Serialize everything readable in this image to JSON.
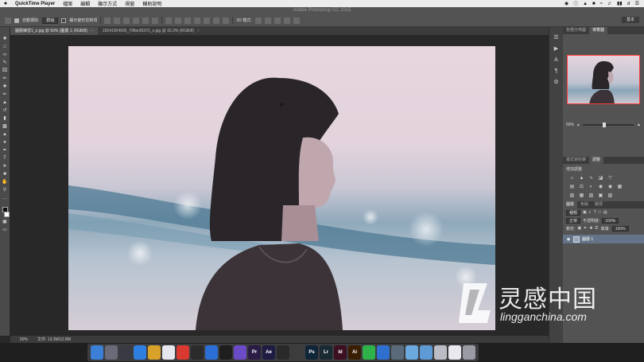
{
  "menubar": {
    "apple": "",
    "app": "QuickTime Player",
    "items": [
      "檔案",
      "編輯",
      "顯示方式",
      "視窗",
      "輔助說明"
    ]
  },
  "app_title": "Adobe Photoshop CC 2015",
  "options": {
    "auto_select_label": "自動選取:",
    "auto_select_value": "群組",
    "show_transform_label": "顯示變形控制項",
    "mode_3d": "3D 模式:",
    "workspace": "基本"
  },
  "tabs": [
    {
      "label": "圖層練習1_o.jpg @ 50% (圖層 1, RGB/8)",
      "close": "×",
      "active": true
    },
    {
      "label": "15041954695_79fbe39372_o.jpg @ 33.3% (RGB/8)",
      "close": "×",
      "active": false
    }
  ],
  "status": {
    "zoom": "50%",
    "doc": "文件: 13.3M/12.8M"
  },
  "navigator": {
    "tabs": [
      "色階分佈圖",
      "導覽器"
    ],
    "zoom": "50%"
  },
  "adjust": {
    "tabs": [
      "樣式資料庫",
      "調整"
    ],
    "subtitle": "增加調整"
  },
  "layers": {
    "tabs": [
      "圖層",
      "色版",
      "路徑"
    ],
    "kind": "種類",
    "blend": "正常",
    "opacity_label": "不透明度:",
    "opacity": "100%",
    "lock_label": "鎖定:",
    "fill_label": "填滿:",
    "fill": "100%",
    "layer_name": "圖層 1"
  },
  "dock_apps": [
    {
      "name": "finder",
      "label": "",
      "color": "#3b7fd6"
    },
    {
      "name": "launchpad",
      "label": "",
      "color": "#6a6a78"
    },
    {
      "name": "mission-control",
      "label": "",
      "color": "#3a3a44"
    },
    {
      "name": "safari",
      "label": "",
      "color": "#2f7fe0"
    },
    {
      "name": "chrome",
      "label": "",
      "color": "#d8a22a"
    },
    {
      "name": "itunes",
      "label": "",
      "color": "#e6e6ee"
    },
    {
      "name": "photo-booth",
      "label": "",
      "color": "#d9392f"
    },
    {
      "name": "activity-monitor",
      "label": "",
      "color": "#2b2b2b"
    },
    {
      "name": "app-store",
      "label": "",
      "color": "#2b6fd6"
    },
    {
      "name": "vlc",
      "label": "",
      "color": "#1e1e1e"
    },
    {
      "name": "imovie",
      "label": "",
      "color": "#6b4bc6"
    },
    {
      "name": "premiere",
      "label": "Pr",
      "color": "#2a1c45"
    },
    {
      "name": "after-effects",
      "label": "Ae",
      "color": "#1e1c42"
    },
    {
      "name": "davinci",
      "label": "",
      "color": "#2a2a2a"
    },
    {
      "name": "final-cut",
      "label": "",
      "color": "#3c3c3c"
    },
    {
      "name": "photoshop",
      "label": "Ps",
      "color": "#0e2638"
    },
    {
      "name": "lightroom",
      "label": "Lr",
      "color": "#1a2a33"
    },
    {
      "name": "indesign",
      "label": "Id",
      "color": "#3d0f22"
    },
    {
      "name": "illustrator",
      "label": "Ai",
      "color": "#3a1e04"
    },
    {
      "name": "wechat",
      "label": "",
      "color": "#2fb24a"
    },
    {
      "name": "keynote",
      "label": "",
      "color": "#2f6fd0"
    },
    {
      "name": "preview",
      "label": "",
      "color": "#5a6a7a"
    },
    {
      "name": "folder-1",
      "label": "",
      "color": "#6aa8dd"
    },
    {
      "name": "folder-2",
      "label": "",
      "color": "#5e9ad6"
    },
    {
      "name": "screen",
      "label": "",
      "color": "#bcbcc6"
    },
    {
      "name": "document",
      "label": "",
      "color": "#e8e8ee"
    },
    {
      "name": "trash",
      "label": "",
      "color": "#9a9aa4"
    }
  ],
  "watermark": {
    "title": "灵感中国",
    "url": "lingganchina.com"
  }
}
